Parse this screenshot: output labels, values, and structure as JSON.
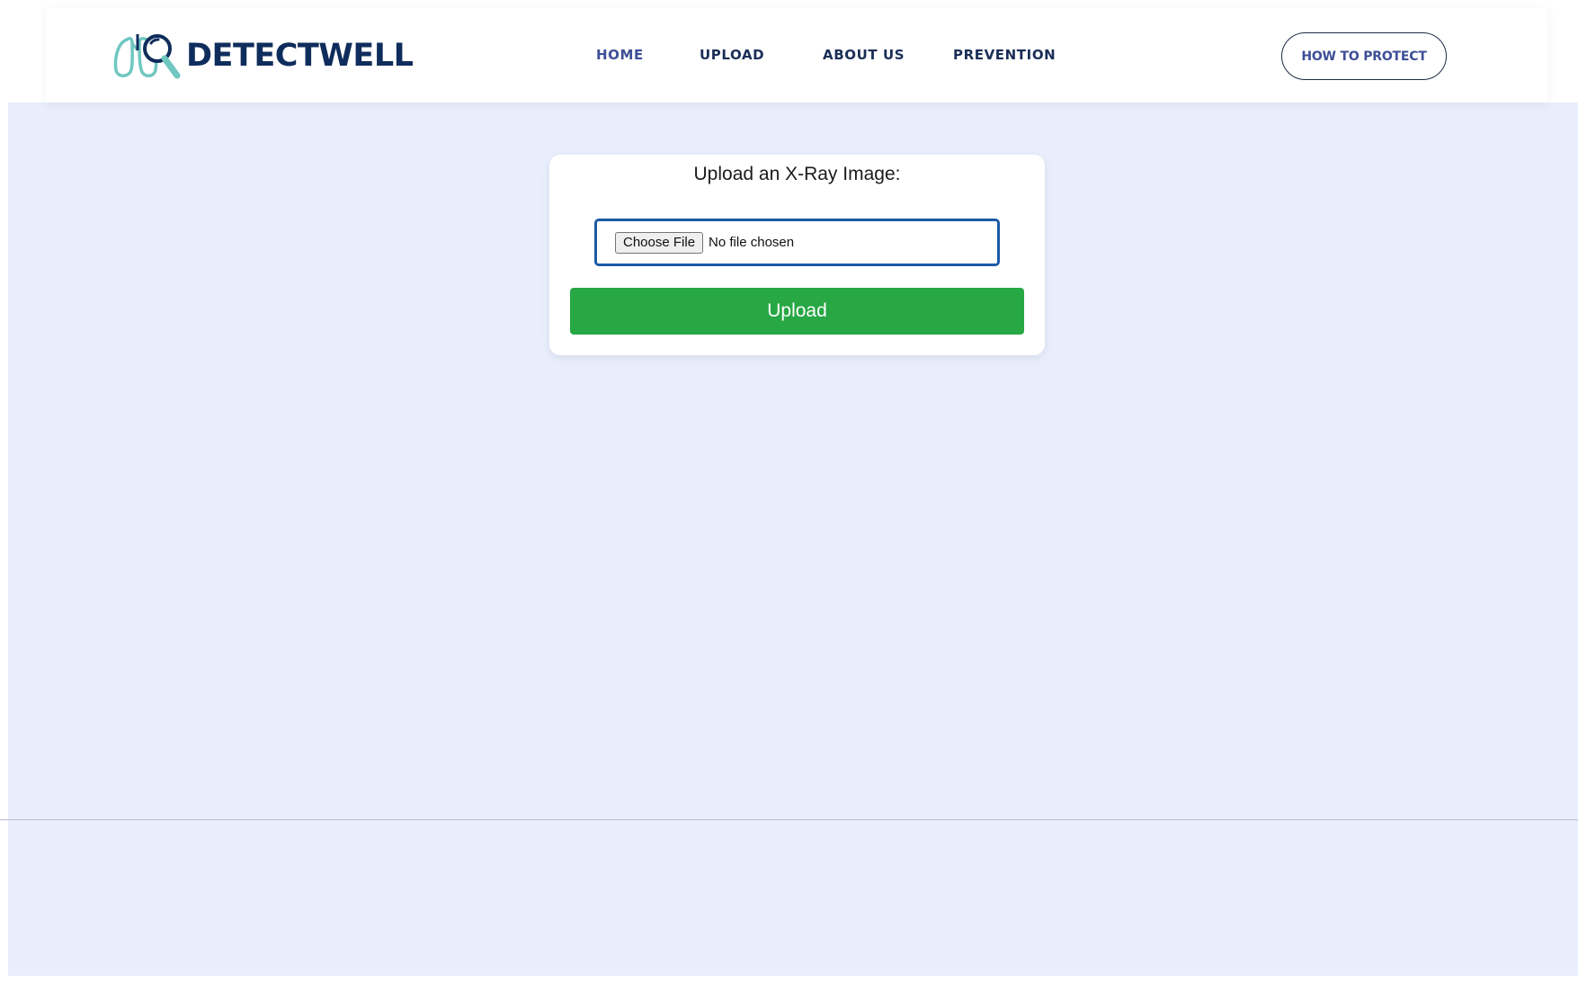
{
  "brand": {
    "name": "DETECTWELL",
    "logo_icon": "lungs-magnifier-icon",
    "colors": {
      "navy": "#0f2d5c",
      "teal": "#6fc7c0"
    }
  },
  "nav": {
    "items": [
      {
        "label": "HOME",
        "active": true
      },
      {
        "label": "UPLOAD",
        "active": false
      },
      {
        "label": "ABOUT US",
        "active": false
      },
      {
        "label": "PREVENTION",
        "active": false
      }
    ],
    "cta_label": "HOW TO PROTECT"
  },
  "upload_card": {
    "title": "Upload an X-Ray Image:",
    "choose_file_label": "Choose File",
    "file_status": "No file chosen",
    "submit_label": "Upload",
    "submit_color": "#28a745",
    "input_border_color": "#1b5aa6"
  },
  "theme": {
    "page_background": "#e8eefc"
  }
}
